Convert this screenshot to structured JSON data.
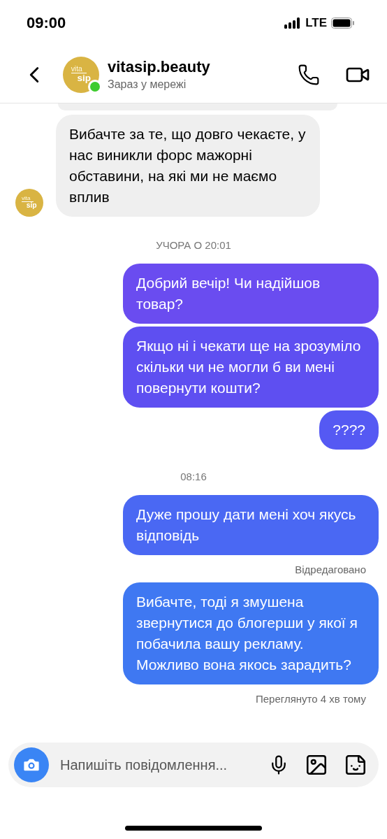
{
  "status_bar": {
    "time": "09:00",
    "network": "LTE"
  },
  "header": {
    "title": "vitasip.beauty",
    "status": "Зараз у мережі",
    "online": true,
    "avatar": {
      "line_1": "vita",
      "line_2": "sip"
    }
  },
  "messages": [
    {
      "kind": "clipped_received"
    },
    {
      "kind": "received",
      "text": "Вибачте за те, що довго чекаєте, у нас виникли форс мажорні обставини, на які ми не маємо вплив",
      "avatar": {
        "line_1": "vita",
        "line_2": "sip"
      }
    },
    {
      "kind": "timestamp",
      "text": "УЧОРА О 20:01"
    },
    {
      "kind": "sent",
      "text": "Добрий вечір! Чи надійшов товар?"
    },
    {
      "kind": "sent",
      "text": "Якщо ні і чекати ще на зрозуміло скільки чи не могли б ви мені повернути кошти?"
    },
    {
      "kind": "sent",
      "text": "????"
    },
    {
      "kind": "timestamp",
      "text": "08:16"
    },
    {
      "kind": "sent",
      "text": "Дуже прошу дати мені хоч якусь відповідь"
    },
    {
      "kind": "note",
      "text": "Відредаговано"
    },
    {
      "kind": "sent",
      "text": "Вибачте, тоді я змушена звернутися до блогерши у якої я побачила вашу рекламу. Можливо вона якось зарадить?"
    },
    {
      "kind": "note",
      "text": "Переглянуто 4 хв тому"
    }
  ],
  "composer": {
    "placeholder": "Напишіть повідомлення..."
  }
}
